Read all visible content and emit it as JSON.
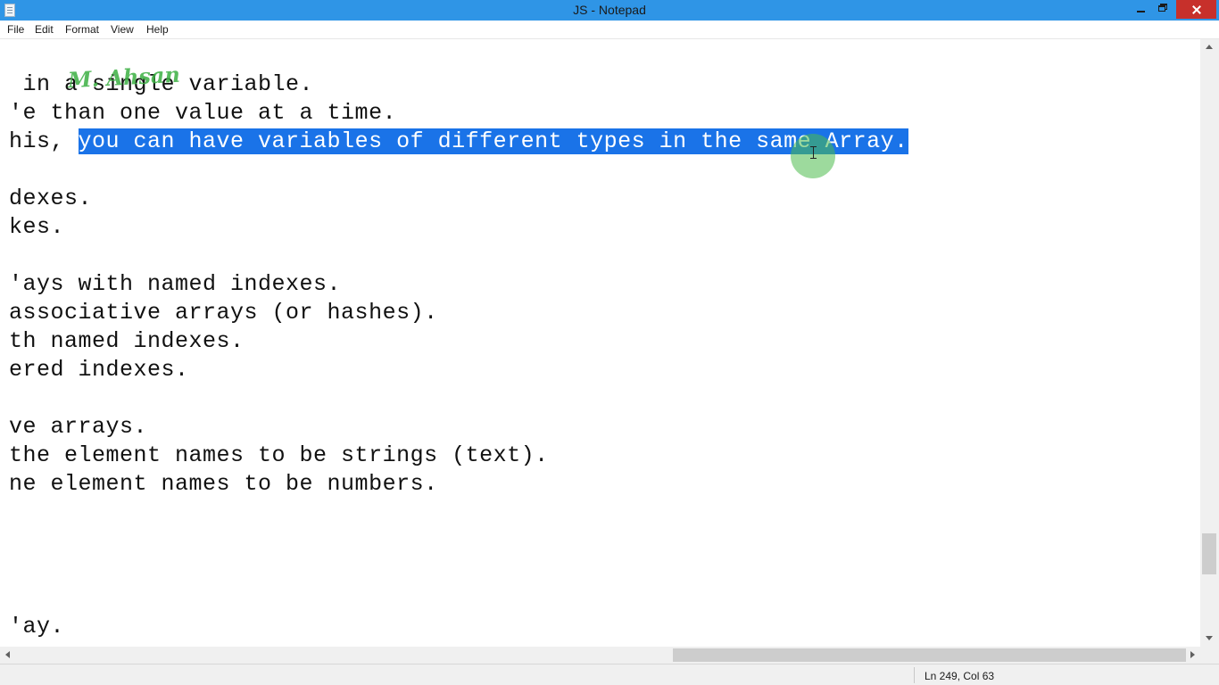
{
  "window": {
    "title": "JS - Notepad",
    "icon": "notepad-icon",
    "close_color": "#c7302b",
    "titlebar_color": "#2f95e6"
  },
  "menu": [
    "File",
    "Edit",
    "Format",
    "View",
    "Help"
  ],
  "editor": {
    "watermark": "M. Ahsan",
    "lines": [
      " in a single variable.",
      "'e than one value at a time.",
      "his, ",
      "",
      "dexes.",
      "kes.",
      "",
      "'ays with named indexes.",
      "associative arrays (or hashes).",
      "th named indexes.",
      "ered indexes.",
      "",
      "ve arrays.",
      "the element names to be strings (text).",
      "ne element names to be numbers.",
      "",
      "",
      "",
      "",
      "'ay."
    ],
    "selected_text": "you can have variables of different types in the same Array.",
    "selection_color": "#1a73e8"
  },
  "status": {
    "position": "Ln 249, Col 63"
  }
}
